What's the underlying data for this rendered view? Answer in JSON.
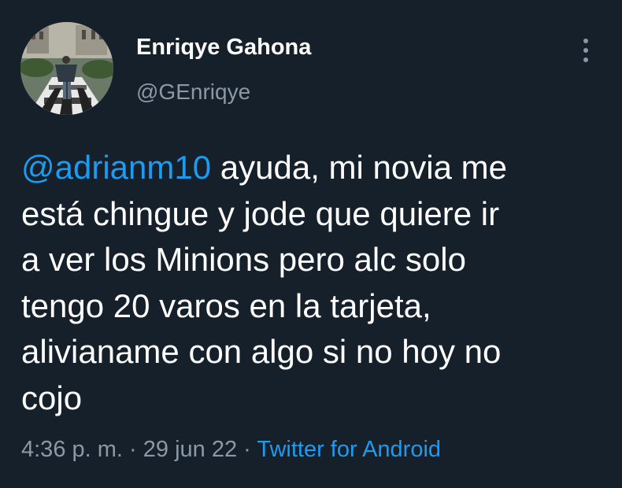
{
  "author": {
    "display_name": "Enriqye Gahona",
    "handle": "@GEnriqye"
  },
  "tweet": {
    "mention": "@adrianm10",
    "lines": [
      " ayuda, mi novia me",
      "está chingue y jode que quiere ir",
      "a ver los Minions pero alc solo",
      "tengo 20 varos en la tarjeta,",
      "alivianame con algo si no hoy no",
      "cojo"
    ]
  },
  "meta": {
    "time": "4:36 p. m.",
    "separator": " · ",
    "date": "29 jun 22",
    "source": "Twitter for Android"
  },
  "icons": {
    "more": "more-vertical-icon",
    "avatar": "profile-photo"
  },
  "colors": {
    "background": "#15202b",
    "text": "#ffffff",
    "secondary": "#8b98a5",
    "accent": "#1d9bf0"
  }
}
